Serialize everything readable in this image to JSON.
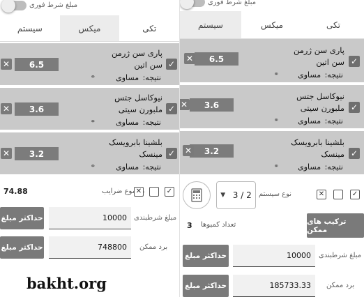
{
  "colors": {
    "bet_bg": "#c9c9c9",
    "odds_bg": "#7c7c7c",
    "button_bg": "#7a7a7a",
    "active_tab_bg": "#ececec"
  },
  "left_panel": {
    "instant_condition_label": "مبلغ شرط فوری",
    "tabs": [
      {
        "label": "تکی",
        "active": false
      },
      {
        "label": "میکس",
        "active": true
      },
      {
        "label": "سیستم",
        "active": false
      }
    ],
    "bets": [
      {
        "team_line1": "پاری سن ژرمن",
        "team_line2": "سن اتین",
        "result_label": "نتیجه:",
        "result_value": "مساوی",
        "odds": "6.5"
      },
      {
        "team_line1": "نیوکاسل جتس",
        "team_line2": "ملبورن سیتی",
        "result_label": "نتیجه:",
        "result_value": "مساوی",
        "odds": "3.6"
      },
      {
        "team_line1": "بلشینا بابرویسک",
        "team_line2": "مینسک",
        "result_label": "نتیجه:",
        "result_value": "مساوی",
        "odds": "3.2"
      }
    ],
    "total_odds_label": "مجموع ضرایب",
    "total_odds_value": "74.88",
    "stake_label": "مبلغ شرطبندی",
    "stake_value": "10000",
    "possible_win_label": "برد ممکن",
    "possible_win_value": "748800",
    "max_amount_label": "حداکثر مبلغ"
  },
  "right_panel": {
    "instant_condition_label": "مبلغ شرط فوری",
    "tabs": [
      {
        "label": "تکی",
        "active": false
      },
      {
        "label": "میکس",
        "active": false
      },
      {
        "label": "سیستم",
        "active": true
      }
    ],
    "bets": [
      {
        "team_line1": "پاری سن ژرمن",
        "team_line2": "سن اتین",
        "result_label": "نتیجه:",
        "result_value": "مساوی",
        "odds": "6.5"
      },
      {
        "team_line1": "نیوکاسل جتس",
        "team_line2": "ملبورن سیتی",
        "result_label": "نتیجه:",
        "result_value": "مساوی",
        "odds": "3.6"
      },
      {
        "team_line1": "بلشینا بابرویسک",
        "team_line2": "مینسک",
        "result_label": "نتیجه:",
        "result_value": "مساوی",
        "odds": "3.2"
      }
    ],
    "system_type_label": "نوع سیستم",
    "system_type_value": "3 / 2",
    "possible_combinations_button": "ترکیب های ممکن",
    "combo_count_label": "تعداد کمبوها",
    "combo_count_value": "3",
    "stake_label": "مبلغ شرطبندی",
    "stake_value": "10000",
    "possible_win_label": "برد ممکن",
    "possible_win_value": "185733.33",
    "max_amount_label": "حداکثر مبلغ"
  },
  "watermark": "bakht.org",
  "icons": {
    "check": "checkbox-checked-icon",
    "close": "close-x-icon",
    "copy": "copy-icon",
    "delete": "delete-box-icon",
    "link": "link-icon",
    "calculator": "calculator-icon",
    "dropdown": "caret-down-icon"
  }
}
